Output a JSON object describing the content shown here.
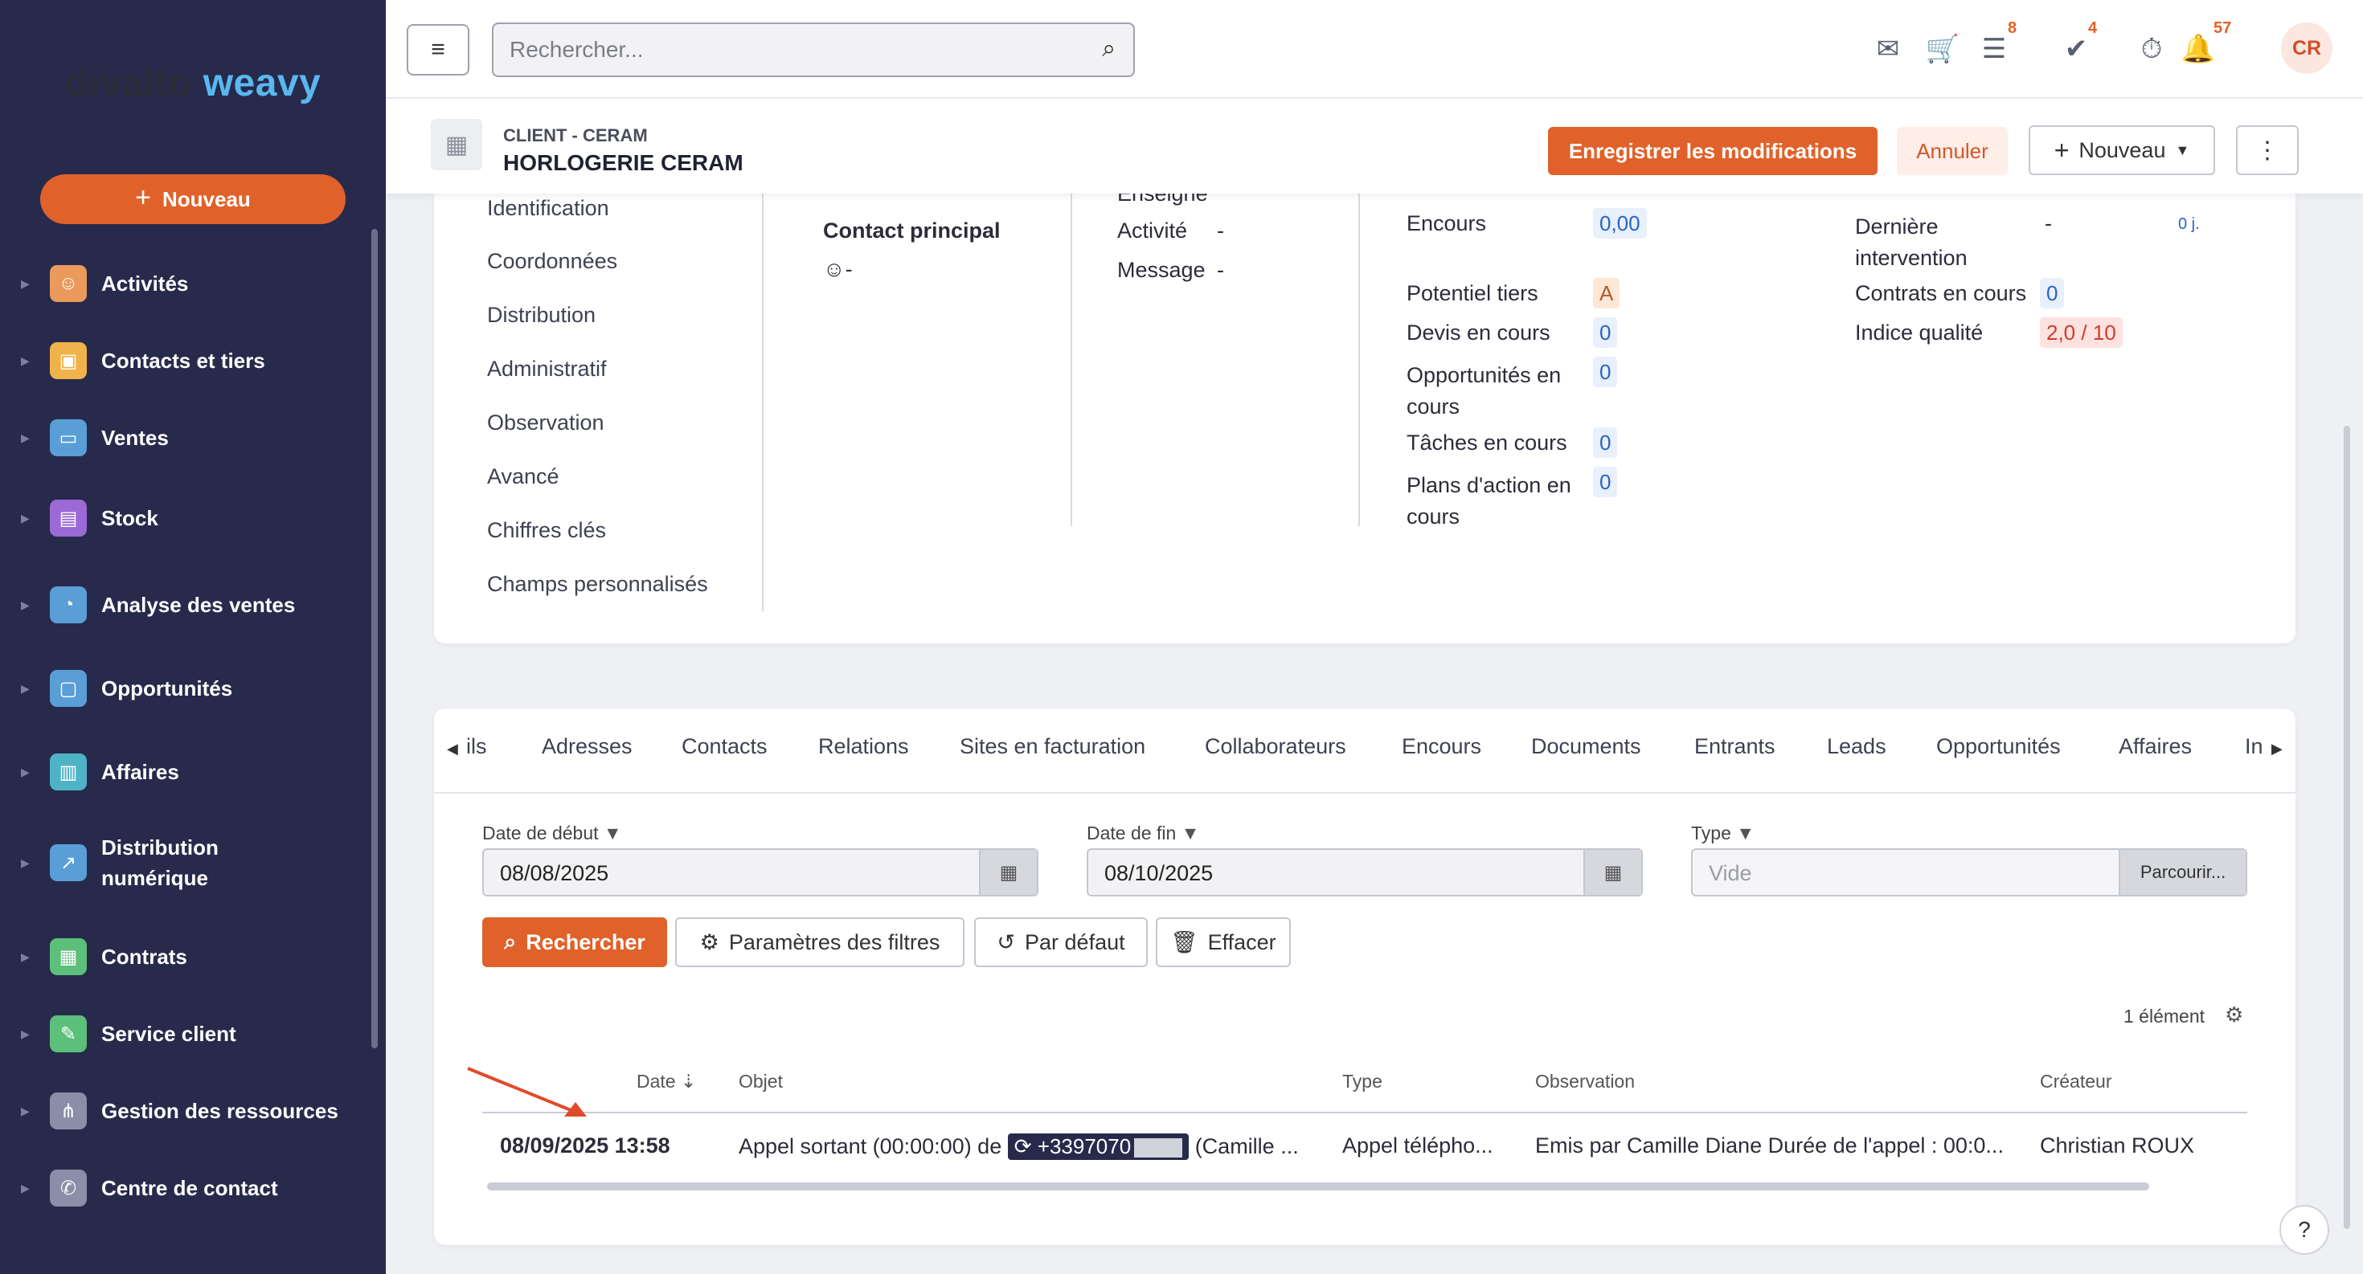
{
  "sidebar": {
    "brand_part1": "divalto",
    "brand_part2": "weavy",
    "new_label": "Nouveau",
    "items": [
      {
        "label": "Activités",
        "color": "#e99a5c"
      },
      {
        "label": "Contacts et tiers",
        "color": "#f0b24a"
      },
      {
        "label": "Ventes",
        "color": "#5a9ed8"
      },
      {
        "label": "Stock",
        "color": "#9b6ad6"
      },
      {
        "label": "Analyse des ventes",
        "color": "#5a9ed8"
      },
      {
        "label": "Opportunités",
        "color": "#5a9ed8"
      },
      {
        "label": "Affaires",
        "color": "#4fb3c8"
      },
      {
        "label": "Distribution numérique",
        "color": "#5a9ed8"
      },
      {
        "label": "Contrats",
        "color": "#5cbf7a"
      },
      {
        "label": "Service client",
        "color": "#5cbf7a"
      },
      {
        "label": "Gestion des ressources",
        "color": "#8a8ea8"
      },
      {
        "label": "Centre de contact",
        "color": "#8a8ea8"
      }
    ]
  },
  "topbar": {
    "search_placeholder": "Rechercher...",
    "badges": {
      "list": "8",
      "tasks": "4",
      "notifications": "57"
    },
    "avatar": "CR"
  },
  "record": {
    "kind": "CLIENT - CERAM",
    "name": "HORLOGERIE CERAM",
    "save_label": "Enregistrer les modifications",
    "cancel_label": "Annuler",
    "new_label": "Nouveau"
  },
  "sections": [
    "Identification",
    "Coordonnées",
    "Distribution",
    "Administratif",
    "Observation",
    "Avancé",
    "Chiffres clés",
    "Champs personnalisés"
  ],
  "contact": {
    "title": "Contact principal",
    "value": "-",
    "partial_label": "Enseigne",
    "activite_label": "Activité",
    "activite_value": "-",
    "message_label": "Message",
    "message_value": "-"
  },
  "kpis": {
    "encours_label": "Encours",
    "encours_value": "0,00",
    "potentiel_label": "Potentiel tiers",
    "potentiel_value": "A",
    "devis_label": "Devis en cours",
    "devis_value": "0",
    "opp_label": "Opportunités en cours",
    "opp_value": "0",
    "taches_label": "Tâches en cours",
    "taches_value": "0",
    "plans_label": "Plans d'action en cours",
    "plans_value": "0",
    "derniere_label": "Dernière intervention",
    "derniere_value": "-",
    "derniere_days": "0 j.",
    "contrats_label": "Contrats en cours",
    "contrats_value": "0",
    "qualite_label": "Indice qualité",
    "qualite_value": "2,0 / 10"
  },
  "tabs": [
    "ils",
    "Adresses",
    "Contacts",
    "Relations",
    "Sites en facturation",
    "Collaborateurs",
    "Encours",
    "Documents",
    "Entrants",
    "Leads",
    "Opportunités",
    "Affaires",
    "In"
  ],
  "filters": {
    "start_label": "Date de début",
    "start_value": "08/08/2025",
    "end_label": "Date de fin",
    "end_value": "08/10/2025",
    "type_label": "Type",
    "type_placeholder": "Vide",
    "browse_label": "Parcourir...",
    "search_label": "Rechercher",
    "params_label": "Paramètres des filtres",
    "default_label": "Par défaut",
    "clear_label": "Effacer"
  },
  "table": {
    "count": "1 élément",
    "headers": [
      "Date",
      "Objet",
      "Type",
      "Observation",
      "Créateur"
    ],
    "row": {
      "date": "08/09/2025 13:58",
      "objet_prefix": "Appel sortant (00:00:00) de",
      "phone": "+3397070",
      "objet_suffix": "(Camille ...",
      "type": "Appel télépho...",
      "observation": "Emis par Camille Diane Durée de l'appel : 00:0...",
      "createur": "Christian ROUX"
    }
  },
  "help": "?"
}
